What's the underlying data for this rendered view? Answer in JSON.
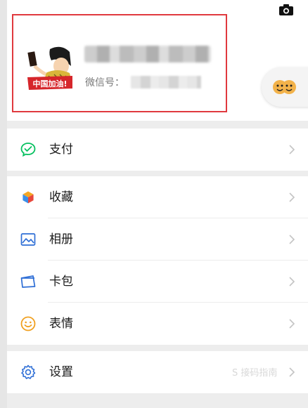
{
  "profile": {
    "wechat_id_label": "微信号：",
    "avatar_banner_text": "中国加油!"
  },
  "menu": {
    "pay": {
      "label": "支付",
      "icon": "wechat-pay-icon"
    },
    "favorites": {
      "label": "收藏",
      "icon": "favorites-cube-icon"
    },
    "album": {
      "label": "相册",
      "icon": "album-image-icon"
    },
    "cards": {
      "label": "卡包",
      "icon": "card-wallet-icon"
    },
    "stickers": {
      "label": "表情",
      "icon": "smiley-icon"
    },
    "settings": {
      "label": "设置",
      "icon": "gear-icon"
    }
  },
  "watermark": "S 接码指南",
  "colors": {
    "highlight": "#e0393e",
    "pay_green": "#07c160",
    "album_blue": "#2f6fd6",
    "sticker_orange": "#f0a020",
    "settings_blue": "#2f6fd6"
  }
}
